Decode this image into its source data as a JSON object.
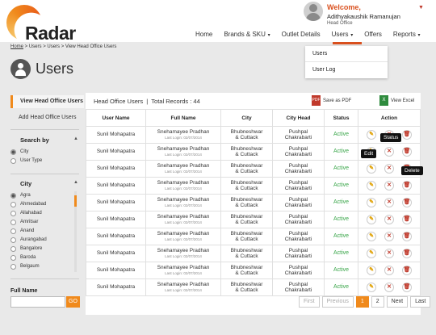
{
  "header": {
    "logo_text": "Radar",
    "welcome": "Welcome,",
    "user_name": "Adithyakaushik Ramanujan",
    "user_role": "Head Office"
  },
  "nav": {
    "items": [
      {
        "label": "Home",
        "caret": false
      },
      {
        "label": "Brands & SKU",
        "caret": true
      },
      {
        "label": "Outlet Details",
        "caret": false
      },
      {
        "label": "Users",
        "caret": true
      },
      {
        "label": "Offers",
        "caret": false
      },
      {
        "label": "Reports",
        "caret": true
      }
    ],
    "dropdown": [
      "Users",
      "User Log"
    ]
  },
  "breadcrumb": {
    "home": "Home",
    "rest": " > Users > Users > View Head Office Users"
  },
  "page_title": "Users",
  "sidebar": {
    "nav": [
      "View Head Office Users",
      "Add Head Office Users"
    ],
    "search_by_title": "Search by",
    "search_by": [
      "City",
      "User Type"
    ],
    "city_title": "City",
    "cities": [
      "Agra",
      "Ahmedabad",
      "Allahabad",
      "Amritsar",
      "Anand",
      "Aurangabad",
      "Bangalore",
      "Baroda",
      "Belgaum"
    ],
    "fullname_label": "Full Name",
    "go": "GO"
  },
  "panel": {
    "title": "Head Office Users",
    "total": "Total Records : 44",
    "pdf": "Save as PDF",
    "excel": "View Excel"
  },
  "table": {
    "headers": [
      "User Name",
      "Full Name",
      "City",
      "City Head",
      "Status",
      "Action"
    ],
    "rows": [
      {
        "user": "Sunil Mohapatra",
        "full": "Snehamayee Pradhan",
        "login": "Last Login: 02/07/2014",
        "city1": "Bhubneshwar",
        "city2": "& Cuttack",
        "head1": "Pushpal",
        "head2": "Chakrabarti",
        "status": "Active"
      },
      {
        "user": "Sunil Mohapatra",
        "full": "Snehamayee Pradhan",
        "login": "Last Login: 02/07/2014",
        "city1": "Bhubneshwar",
        "city2": "& Cuttack",
        "head1": "Pushpal",
        "head2": "Chakrabarti",
        "status": "Active"
      },
      {
        "user": "Sunil Mohapatra",
        "full": "Snehamayee Pradhan",
        "login": "Last Login: 02/07/2014",
        "city1": "Bhubneshwar",
        "city2": "& Cuttack",
        "head1": "Pushpal",
        "head2": "Chakrabarti",
        "status": "Active"
      },
      {
        "user": "Sunil Mohapatra",
        "full": "Snehamayee Pradhan",
        "login": "Last Login: 02/07/2014",
        "city1": "Bhubneshwar",
        "city2": "& Cuttack",
        "head1": "Pushpal",
        "head2": "Chakrabarti",
        "status": "Active"
      },
      {
        "user": "Sunil Mohapatra",
        "full": "Snehamayee Pradhan",
        "login": "Last Login: 02/07/2014",
        "city1": "Bhubneshwar",
        "city2": "& Cuttack",
        "head1": "Pushpal",
        "head2": "Chakrabarti",
        "status": "Active"
      },
      {
        "user": "Sunil Mohapatra",
        "full": "Snehamayee Pradhan",
        "login": "Last Login: 02/07/2014",
        "city1": "Bhubneshwar",
        "city2": "& Cuttack",
        "head1": "Pushpal",
        "head2": "Chakrabarti",
        "status": "Active"
      },
      {
        "user": "Sunil Mohapatra",
        "full": "Snehamayee Pradhan",
        "login": "Last Login: 02/07/2014",
        "city1": "Bhubneshwar",
        "city2": "& Cuttack",
        "head1": "Pushpal",
        "head2": "Chakrabarti",
        "status": "Active"
      },
      {
        "user": "Sunil Mohapatra",
        "full": "Snehamayee Pradhan",
        "login": "Last Login: 02/07/2014",
        "city1": "Bhubneshwar",
        "city2": "& Cuttack",
        "head1": "Pushpal",
        "head2": "Chakrabarti",
        "status": "Active"
      },
      {
        "user": "Sunil Mohapatra",
        "full": "Snehamayee Pradhan",
        "login": "Last Login: 02/07/2014",
        "city1": "Bhubneshwar",
        "city2": "& Cuttack",
        "head1": "Pushpal",
        "head2": "Chakrabarti",
        "status": "Active"
      },
      {
        "user": "Sunil Mohapatra",
        "full": "Snehamayee Pradhan",
        "login": "Last Login: 02/07/2014",
        "city1": "Bhubneshwar",
        "city2": "& Cuttack",
        "head1": "Pushpal",
        "head2": "Chakrabarti",
        "status": "Active"
      }
    ]
  },
  "tooltips": {
    "edit": "Edit",
    "status": "Status",
    "delete": "Delete"
  },
  "pager": {
    "first": "First",
    "prev": "Previous",
    "pages": [
      "1",
      "2"
    ],
    "next": "Next",
    "last": "Last"
  },
  "colors": {
    "accent": "#f08a1c",
    "active": "#3aa64a",
    "danger": "#c0392b"
  }
}
